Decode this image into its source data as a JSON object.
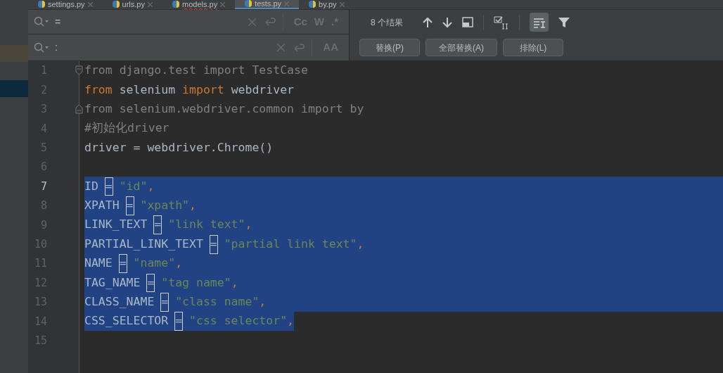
{
  "tabs": [
    {
      "label": "settings.py",
      "selected": false,
      "error": false
    },
    {
      "label": "urls.py",
      "selected": false,
      "error": false
    },
    {
      "label": "models.py",
      "selected": false,
      "error": true
    },
    {
      "label": "tests.py",
      "selected": true,
      "error": false
    },
    {
      "label": "by.py",
      "selected": false,
      "error": false
    }
  ],
  "find": {
    "search": {
      "value": "="
    },
    "replace": {
      "value": ":"
    },
    "search_options": [
      "Cc",
      "W",
      ".*"
    ],
    "replace_options": [
      "AA"
    ],
    "result_count": "8 个结果",
    "in_selection": true,
    "buttons": [
      "替换(P)",
      "全部替换(A)",
      "排除(L)"
    ]
  },
  "editor": {
    "lines": [
      {
        "number": "1",
        "current": false,
        "fold_start": true,
        "fold_end": false,
        "selected": false,
        "segments": [
          {
            "kind": "unused",
            "text": "from django.test import TestCase"
          }
        ]
      },
      {
        "number": "2",
        "current": false,
        "fold_start": false,
        "fold_end": false,
        "selected": false,
        "segments": [
          {
            "kind": "keyword",
            "text": "from"
          },
          {
            "kind": "name",
            "text": " selenium "
          },
          {
            "kind": "keyword",
            "text": "import"
          },
          {
            "kind": "name",
            "text": " webdriver"
          }
        ]
      },
      {
        "number": "3",
        "current": false,
        "fold_start": false,
        "fold_end": true,
        "selected": false,
        "segments": [
          {
            "kind": "unused",
            "text": "from selenium.webdriver.common import by"
          }
        ]
      },
      {
        "number": "4",
        "current": false,
        "fold_start": false,
        "fold_end": false,
        "selected": false,
        "segments": [
          {
            "kind": "comment",
            "text": "#初始化driver"
          }
        ]
      },
      {
        "number": "5",
        "current": false,
        "fold_start": false,
        "fold_end": false,
        "selected": false,
        "segments": [
          {
            "kind": "name",
            "text": "driver = webdriver.Chrome()"
          }
        ]
      },
      {
        "number": "6",
        "current": false,
        "fold_start": false,
        "fold_end": false,
        "selected": false
      },
      {
        "number": "7",
        "current": true,
        "fold_start": false,
        "fold_end": false,
        "selected": true,
        "selection_to_end": true,
        "segments": [
          {
            "kind": "name",
            "text": "ID "
          },
          {
            "kind": "match",
            "text": "="
          },
          {
            "kind": "string",
            "text": " \"id\""
          },
          {
            "kind": "punct",
            "text": ","
          }
        ]
      },
      {
        "number": "8",
        "current": false,
        "fold_start": false,
        "fold_end": false,
        "selected": true,
        "selection_to_end": true,
        "segments": [
          {
            "kind": "name",
            "text": "XPATH "
          },
          {
            "kind": "match",
            "text": "="
          },
          {
            "kind": "string",
            "text": " \"xpath\""
          },
          {
            "kind": "punct",
            "text": ","
          }
        ]
      },
      {
        "number": "9",
        "current": false,
        "fold_start": false,
        "fold_end": false,
        "selected": true,
        "selection_to_end": true,
        "segments": [
          {
            "kind": "name",
            "text": "LINK_TEXT "
          },
          {
            "kind": "match",
            "text": "="
          },
          {
            "kind": "string",
            "text": " \"link text\""
          },
          {
            "kind": "punct",
            "text": ","
          }
        ]
      },
      {
        "number": "10",
        "current": false,
        "fold_start": false,
        "fold_end": false,
        "selected": true,
        "selection_to_end": true,
        "segments": [
          {
            "kind": "name",
            "text": "PARTIAL_LINK_TEXT "
          },
          {
            "kind": "match",
            "text": "="
          },
          {
            "kind": "string",
            "text": " \"partial link text\""
          },
          {
            "kind": "punct",
            "text": ","
          }
        ]
      },
      {
        "number": "11",
        "current": false,
        "fold_start": false,
        "fold_end": false,
        "selected": true,
        "selection_to_end": true,
        "segments": [
          {
            "kind": "name",
            "text": "NAME "
          },
          {
            "kind": "match",
            "text": "="
          },
          {
            "kind": "string",
            "text": " \"name\""
          },
          {
            "kind": "punct",
            "text": ","
          }
        ]
      },
      {
        "number": "12",
        "current": false,
        "fold_start": false,
        "fold_end": false,
        "selected": true,
        "selection_to_end": true,
        "segments": [
          {
            "kind": "name",
            "text": "TAG_NAME "
          },
          {
            "kind": "match",
            "text": "="
          },
          {
            "kind": "string",
            "text": " \"tag name\""
          },
          {
            "kind": "punct",
            "text": ","
          }
        ]
      },
      {
        "number": "13",
        "current": false,
        "fold_start": false,
        "fold_end": false,
        "selected": true,
        "selection_to_end": true,
        "segments": [
          {
            "kind": "name",
            "text": "CLASS_NAME "
          },
          {
            "kind": "match",
            "text": "="
          },
          {
            "kind": "string",
            "text": " \"class name\""
          },
          {
            "kind": "punct",
            "text": ","
          }
        ]
      },
      {
        "number": "14",
        "current": false,
        "fold_start": false,
        "fold_end": false,
        "selected": true,
        "selection_to_end": false,
        "segments": [
          {
            "kind": "name",
            "text": "CSS_SELECTOR "
          },
          {
            "kind": "match",
            "text": "="
          },
          {
            "kind": "string",
            "text": " \"css selector\""
          },
          {
            "kind": "punct",
            "text": ","
          }
        ]
      },
      {
        "number": "15",
        "current": false,
        "fold_start": false,
        "fold_end": false,
        "selected": false
      }
    ]
  }
}
